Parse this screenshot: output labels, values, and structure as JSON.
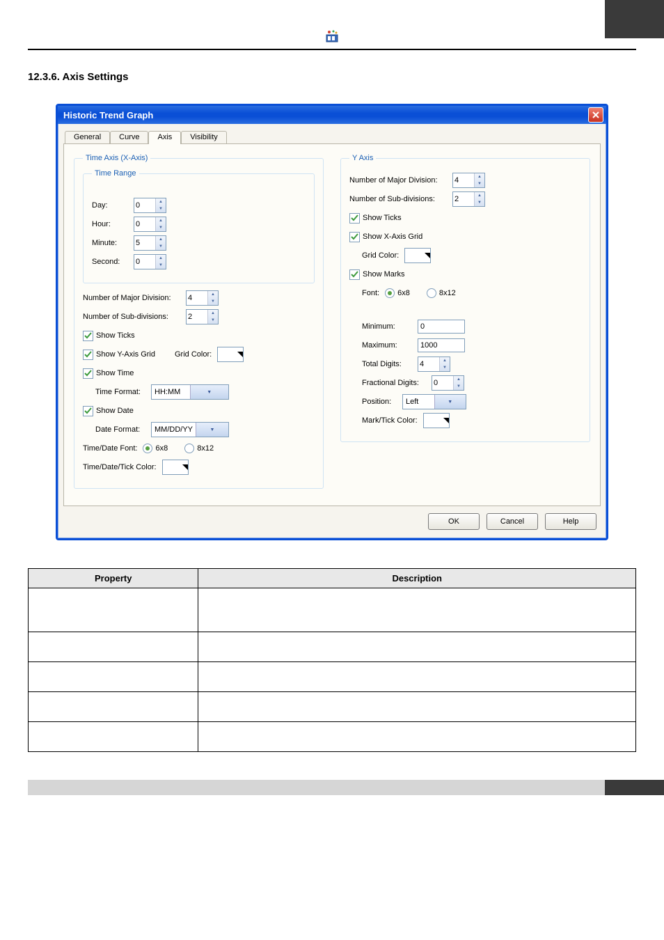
{
  "section_heading": "12.3.6. Axis Settings",
  "dialog": {
    "title": "Historic Trend Graph",
    "tabs": [
      "General",
      "Curve",
      "Axis",
      "Visibility"
    ],
    "active_tab": 2,
    "x_fieldset": "Time Axis (X-Axis)",
    "time_range_legend": "Time Range",
    "day_label": "Day:",
    "day_value": "0",
    "hour_label": "Hour:",
    "hour_value": "0",
    "minute_label": "Minute:",
    "minute_value": "5",
    "second_label": "Second:",
    "second_value": "0",
    "major_div_label": "Number of Major Division:",
    "x_major_div": "4",
    "sub_div_label": "Number of Sub-divisions:",
    "x_sub_div": "2",
    "show_ticks": "Show Ticks",
    "show_yaxis_grid": "Show Y-Axis Grid",
    "grid_color_label": "Grid Color:",
    "show_time": "Show Time",
    "time_format_label": "Time Format:",
    "time_format": "HH:MM",
    "show_date": "Show Date",
    "date_format_label": "Date Format:",
    "date_format": "MM/DD/YY",
    "timedate_font_label": "Time/Date Font:",
    "font_6x8": "6x8",
    "font_8x12": "8x12",
    "timedate_tick_color_label": "Time/Date/Tick Color:",
    "y_fieldset": "Y Axis",
    "y_major_div": "4",
    "y_sub_div": "2",
    "show_xaxis_grid": "Show X-Axis Grid",
    "show_marks": "Show Marks",
    "font_label": "Font:",
    "min_label": "Minimum:",
    "min_value": "0",
    "max_label": "Maximum:",
    "max_value": "1000",
    "total_digits_label": "Total Digits:",
    "total_digits": "4",
    "frac_digits_label": "Fractional Digits:",
    "frac_digits": "0",
    "position_label": "Position:",
    "position": "Left",
    "mark_tick_color_label": "Mark/Tick Color:",
    "ok": "OK",
    "cancel": "Cancel",
    "help": "Help"
  },
  "table": {
    "headers": [
      "Property",
      "Description"
    ],
    "rows": [
      [
        "",
        ""
      ],
      [
        "",
        ""
      ],
      [
        "",
        ""
      ],
      [
        "",
        ""
      ],
      [
        "",
        ""
      ]
    ]
  }
}
